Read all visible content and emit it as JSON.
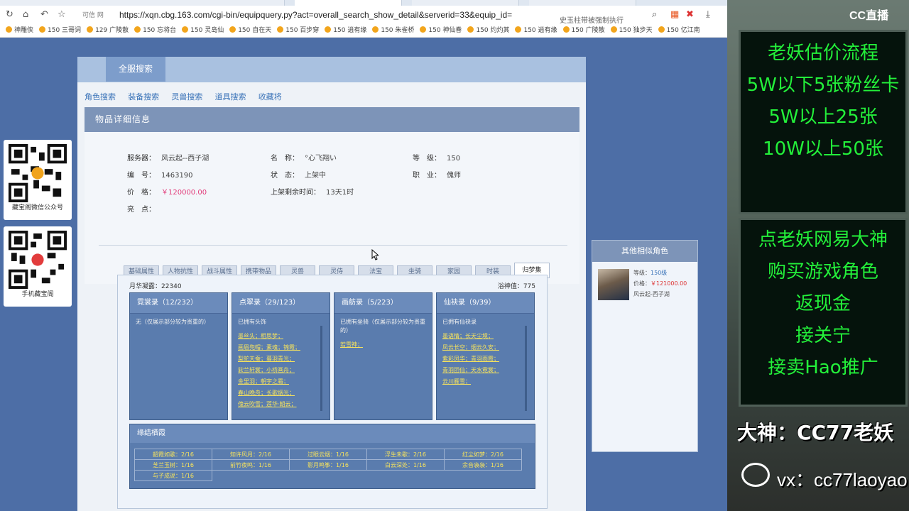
{
  "browser": {
    "badge": "可信 网",
    "url": "https://xqn.cbg.163.com/cgi-bin/equipquery.py?act=overall_search_show_detail&serverid=33&equip_id=",
    "search_hint": "史玉柱带被强制执行",
    "bookmarks": [
      "神雕侠",
      "150 三哥词",
      "129 广陵散",
      "150 忘将台",
      "150 灵岛仙",
      "150 自在天",
      "150 百步穿",
      "150 逍有缘",
      "150 朱雀桥",
      "150 神仙眷",
      "150 灼灼其",
      "150 逍有缘",
      "150 广陵散",
      "150 独步天",
      "150 亿江南"
    ]
  },
  "qr": [
    {
      "caption": "藏宝阁微信公众号"
    },
    {
      "caption": "手机藏宝阁"
    }
  ],
  "panel": {
    "tab": "全服搜索",
    "links": [
      "角色搜索",
      "装备搜索",
      "灵兽搜索",
      "道具搜索",
      "收藏将"
    ],
    "title": "物品详细信息",
    "fields": {
      "server_k": "服务器：",
      "server_v": "风云起--西子湖",
      "name_k": "名　称：",
      "name_v": "°心飞翔い",
      "level_k": "等　级：",
      "level_v": "150",
      "id_k": "编　号：",
      "id_v": "1463190",
      "status_k": "状　态：",
      "status_v": "上架中",
      "job_k": "职　业：",
      "job_v": "傀师",
      "price_k": "价　格：",
      "price_v": "￥120000.00",
      "time_k": "上架剩余时间：",
      "time_v": "13天1时",
      "bright_k": "亮　点："
    },
    "subtabs": [
      "基础属性",
      "人物抗性",
      "战斗属性",
      "携带物品",
      "灵兽",
      "灵侍",
      "法宝",
      "坐骑",
      "家园",
      "时装",
      "归梦集"
    ],
    "meta_left": "月华凝露：22340",
    "meta_right": "浴神值：775",
    "cards": [
      {
        "title": "霓裳录（12/232）",
        "desc": "无（仅展示部分较为贵重的）",
        "items": []
      },
      {
        "title": "点翠录（29/123）",
        "desc": "已拥有头饰",
        "items": [
          "墨丝头；相思梦；",
          "画眉兜帽；素魂；锦霞；",
          "梨蛇天蚕；暮羽青光；",
          "软兰轩裳；小桥画舟；",
          "金里羽；朝宇之霜；",
          "春山晚舟；长歌烟光；",
          "傀云吹雪；莲华·朝云；"
        ]
      },
      {
        "title": "画舫录（5/223）",
        "desc": "已拥有坐骑（仅展示部分较为贵重的）",
        "items": [
          "若雪神；"
        ]
      },
      {
        "title": "仙袂录（9/39）",
        "desc": "已拥有仙袂录",
        "items": [
          "墨语情；长天尘境；",
          "凤云长空；烟云久安；",
          "紫彩凤华；青羽雨霞；",
          "青羽团仙；天水霓裳；",
          "云川雁雪；"
        ]
      }
    ],
    "fate": {
      "title": "缘结栖霞",
      "cells": [
        [
          "韶霞如歌：2/16",
          "知许风月：2/16",
          "过眼云烟：1/16",
          "浮生未歇：2/16",
          "红尘如梦：2/16"
        ],
        [
          "芝兰玉树：1/16",
          "前竹夜鸣：1/16",
          "影月鸣筝：1/16",
          "白云深处：1/16",
          "余音袅袅：1/16"
        ],
        [
          "与子成说：1/16",
          "",
          "",
          "",
          ""
        ]
      ]
    }
  },
  "side": {
    "title": "其他相似角色",
    "level_label": "等级：",
    "level_value": "150级",
    "price_label": "价格：",
    "price_value": "￥121000.00",
    "server": "风云起-西子湖"
  },
  "stream": {
    "logo": "CC直播",
    "sign1": [
      "老妖估价流程",
      "5W以下5张粉丝卡",
      "5W以上25张",
      "10W以上50张"
    ],
    "sign2": [
      "点老妖网易大神",
      "购买游戏角色",
      "返现金",
      "接关宁",
      "接卖Hao推广"
    ],
    "banner": "大神：CC77老妖",
    "vx": "vx：cc77laoyao"
  }
}
